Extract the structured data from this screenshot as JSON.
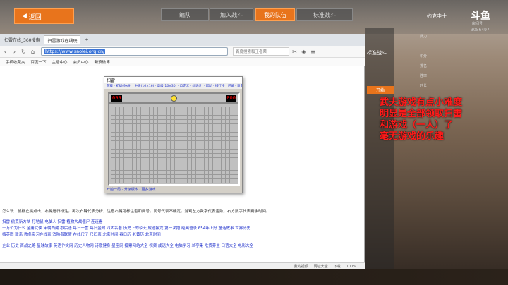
{
  "game_ui": {
    "back_button": "返回",
    "tabs": [
      "编队",
      "加入战斗",
      "我的队伍",
      "标准战斗"
    ],
    "player_name": "约克中士",
    "platform_logo": "斗鱼",
    "room_label": "房间号",
    "room_number": "3056497",
    "mode_title": "标准战斗",
    "start_button": "开始",
    "stats": [
      "武力",
      "积分",
      "排名",
      "胜率",
      "时长"
    ]
  },
  "overlay_text": [
    "武夫游戏有点小难度",
    "明显是全部领取扫雷",
    "和游戏（一人）了",
    "毫无游戏的乐趣"
  ],
  "browser": {
    "tabs": [
      "扫雷在线_360搜索",
      "扫雷游戏在线玩"
    ],
    "url": "https://www.saolei.org.cn/",
    "search_placeholder": "百度搜索和王者荣",
    "bookmarks": [
      "手机收藏夹",
      "百度一下",
      "主播中心",
      "会员中心",
      "新浪微博"
    ],
    "status_items": [
      "我的视频",
      "网址大全",
      "下载",
      "100%"
    ]
  },
  "minesweeper": {
    "title": "扫雷",
    "menu": "游戏 · 初级(9×9) · 中级(16×16) · 高级(16×30) · 自定义 · 标记(?) · 帮助 · 排行榜 · 记录 · 设置",
    "mines_left": "099",
    "timer": "000",
    "footer": "开始一局 · 升级版本 · 更多游戏"
  },
  "page": {
    "instructions": "怎么玩：鼠标左键点击，右键进行标注。再次右键代表分析，注意右键可标注雷和问号。问号代表不确定。游戏左方数字代表雷数，右方数字代表剩余时间。",
    "link_rows": [
      "扫雷  偷菜新方块  打地鼠  电脑人  扫雷  植物大战僵尸  连连看",
      "十万个为什么  金庸武侠  宋朝西藏  歇后语  每日一言  每日金句  四大名著  历史上的今天  成语接龙  第一次播  经典语录  654年上好  童话故事  世界历史",
      "撰英图  联系  教务实习在线表  消除者联盟  在线尺子  尺码表  北京时间  春日历  老黄历  北京时间",
      "企业 历史 百战之路 星球故事 英语作文网 历史人物网 诗歌健身 星座网 投票网站大全 视频 成语大全 电脑学习 兰亭集 吃货养生 口语大全 电影大全"
    ]
  }
}
